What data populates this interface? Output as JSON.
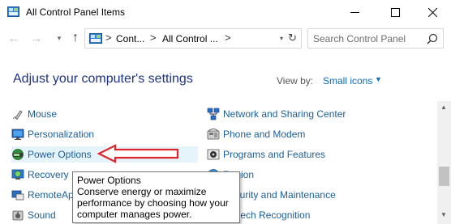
{
  "window": {
    "title": "All Control Panel Items",
    "minimize_glyph": "—",
    "close_glyph": "✕"
  },
  "nav": {
    "back_glyph": "←",
    "forward_glyph": "→",
    "recent_glyph": "▾",
    "up_glyph": "↑"
  },
  "address": {
    "crumbs": [
      "Cont...",
      "All Control ..."
    ],
    "separator": ">",
    "dropdown_glyph": "▾",
    "refresh_glyph": "↻"
  },
  "search": {
    "placeholder": "Search Control Panel"
  },
  "heading": "Adjust your computer's settings",
  "view_by": {
    "label": "View by:",
    "value": "Small icons",
    "caret": "▼"
  },
  "left_items": [
    {
      "label": "Mouse",
      "icon": "mouse-icon"
    },
    {
      "label": "Personalization",
      "icon": "personalization-icon"
    },
    {
      "label": "Power Options",
      "icon": "power-options-icon",
      "highlighted": true
    },
    {
      "label": "Recovery",
      "icon": "recovery-icon"
    },
    {
      "label": "RemoteApp",
      "icon": "remoteapp-icon"
    },
    {
      "label": "Sound",
      "icon": "sound-icon"
    }
  ],
  "right_items": [
    {
      "label": "Network and Sharing Center",
      "icon": "network-icon"
    },
    {
      "label": "Phone and Modem",
      "icon": "phone-icon"
    },
    {
      "label": "Programs and Features",
      "icon": "programs-icon"
    },
    {
      "label": "Region",
      "icon": "region-icon"
    },
    {
      "label": "Security and Maintenance",
      "icon": "security-flag-icon"
    },
    {
      "label": "Speech Recognition",
      "icon": "speech-icon"
    }
  ],
  "tooltip": {
    "title": "Power Options",
    "body": "Conserve energy or maximize performance by choosing how your computer manages power."
  },
  "scrollbar": {
    "up_glyph": "▲",
    "down_glyph": "▼"
  },
  "colors": {
    "link": "#1a5e9a",
    "heading": "#1e3287",
    "accent": "#0a6bc2",
    "hover": "#e5f3fb",
    "annotation_arrow": "#e0262a"
  }
}
